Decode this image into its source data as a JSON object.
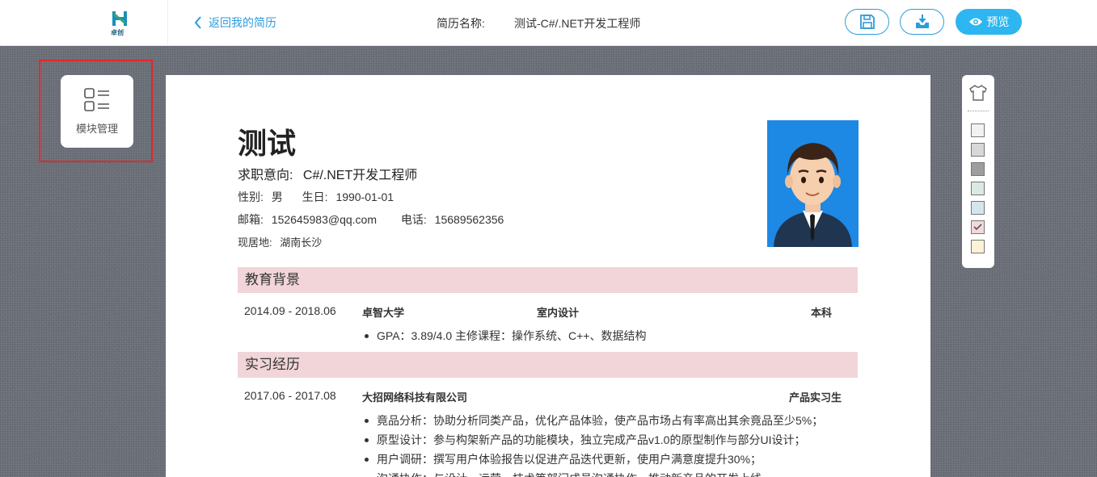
{
  "header": {
    "logo_text": "卓创",
    "back_label": "返回我的简历",
    "resume_name_label": "简历名称:",
    "resume_name_value": "测试-C#/.NET开发工程师",
    "preview_label": "预览"
  },
  "sidebar": {
    "module_label": "模块管理"
  },
  "resume": {
    "name": "测试",
    "intent_label": "求职意向:",
    "intent_value": "C#/.NET开发工程师",
    "gender_label": "性别:",
    "gender_value": "男",
    "birthday_label": "生日:",
    "birthday_value": "1990-01-01",
    "email_label": "邮箱:",
    "email_value": "152645983@qq.com",
    "phone_label": "电话:",
    "phone_value": "15689562356",
    "residence_label": "现居地:",
    "residence_value": "湖南长沙",
    "education": {
      "title": "教育背景",
      "period": "2014.09 - 2018.06",
      "school": "卓智大学",
      "major": "室内设计",
      "degree": "本科",
      "details": [
        "GPA：3.89/4.0 主修课程：操作系统、C++、数据结构"
      ]
    },
    "internship": {
      "title": "实习经历",
      "period": "2017.06 - 2017.08",
      "company": "大招网络科技有限公司",
      "role": "产品实习生",
      "details": [
        "竟品分析：协助分析同类产品，优化产品体验，使产品市场占有率高出其余竟品至少5%；",
        "原型设计：参与构架新产品的功能模块，独立完成产品v1.0的原型制作与部分UI设计；",
        "用户调研：撰写用户体验报告以促进产品迭代更新，使用户满意度提升30%；",
        "沟通协作：与设计、运营、技术等部门成员沟通协作，推动新产品的开发上线。"
      ]
    }
  },
  "palette": {
    "colors": [
      "#f2f2f2",
      "#d8d8d8",
      "#9e9e9e",
      "#dbe9e3",
      "#d5e5ee",
      "#f3d8dc",
      "#fbf2d8"
    ],
    "selected_index": 5,
    "icons": [
      "tshirt-icon",
      "check-icon"
    ]
  },
  "accent_color": "#2d9cdb"
}
